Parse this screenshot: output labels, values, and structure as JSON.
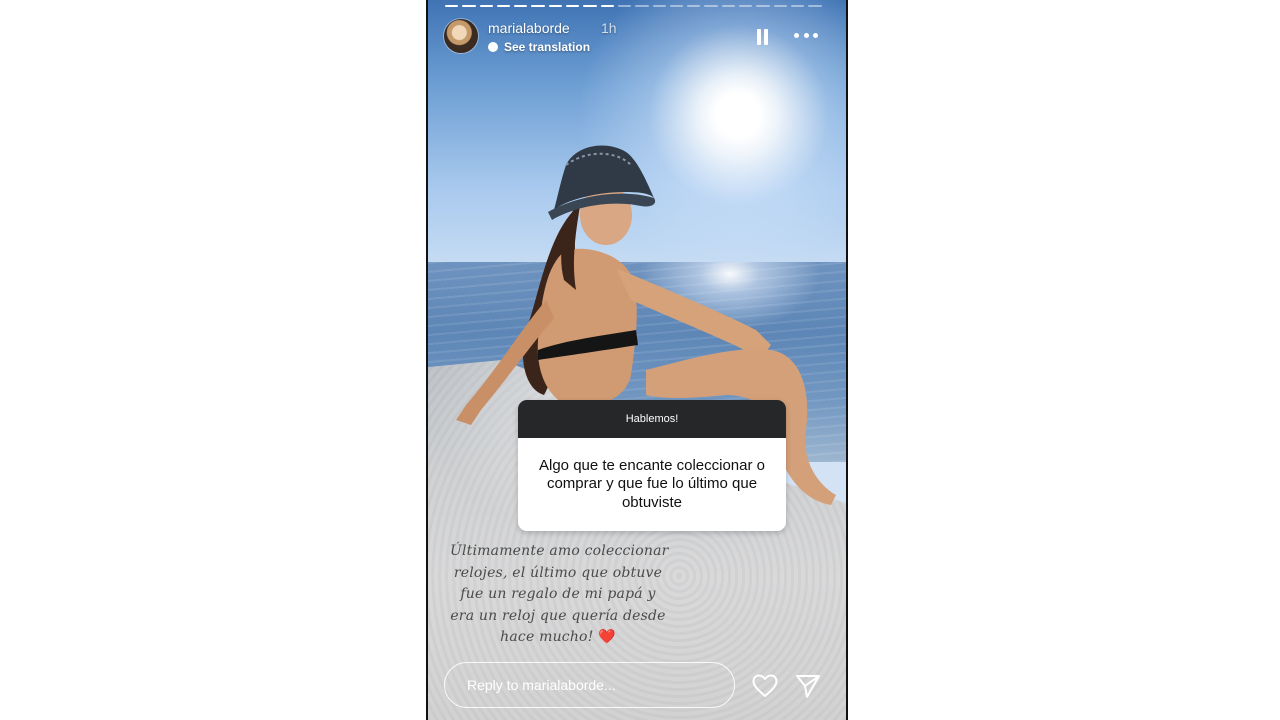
{
  "story": {
    "segments_total": 22,
    "segments_done": 10,
    "header": {
      "username": "marialaborde",
      "time": "1h",
      "see_translation": "See translation",
      "pause_icon": "pause-icon",
      "more_icon": "more-icon"
    },
    "question_sticker": {
      "title": "Hablemos!",
      "question": "Algo que te encante coleccionar o comprar y que fue lo último que obtuviste"
    },
    "caption": {
      "lines": [
        "Últimamente amo coleccionar",
        "relojes, el último que obtuve",
        "fue un regalo de mi papá y",
        "era un reloj que quería desde",
        "hace mucho! "
      ],
      "emoji": "❤️"
    },
    "reply": {
      "placeholder": "Reply to marialaborde...",
      "like_icon": "heart-icon",
      "send_icon": "send-icon"
    }
  }
}
